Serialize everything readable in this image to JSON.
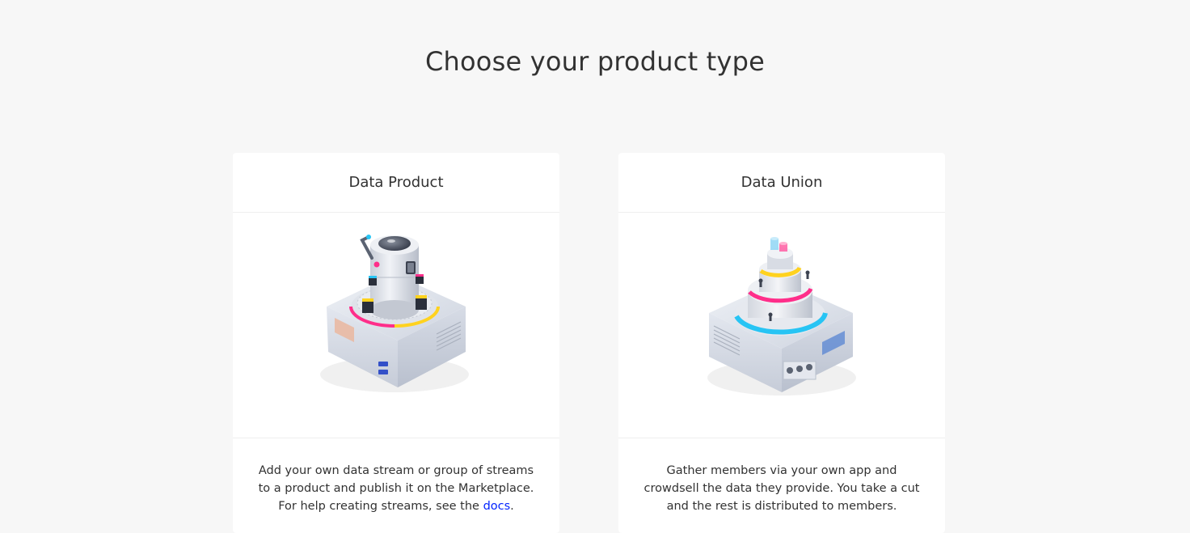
{
  "page": {
    "title": "Choose your product type"
  },
  "cards": [
    {
      "title": "Data Product",
      "illustration": "data-product-machine-illustration",
      "description_lines": [
        "Add your own data stream or group of streams",
        "to a product and publish it on the Marketplace."
      ],
      "help_prefix": "For help creating streams, see the ",
      "help_link": "docs",
      "help_suffix": "."
    },
    {
      "title": "Data Union",
      "illustration": "data-union-machine-illustration",
      "description_lines": [
        "Gather members via your own app and",
        "crowdsell the data they provide. You take a cut",
        "and the rest is distributed to members."
      ]
    }
  ],
  "colors": {
    "background": "#f7f7f7",
    "card": "#ffffff",
    "text": "#323232",
    "link": "#0324ff",
    "accent_pink": "#ff2e8a",
    "accent_yellow": "#ffd21f",
    "accent_blue": "#27c4f4"
  }
}
